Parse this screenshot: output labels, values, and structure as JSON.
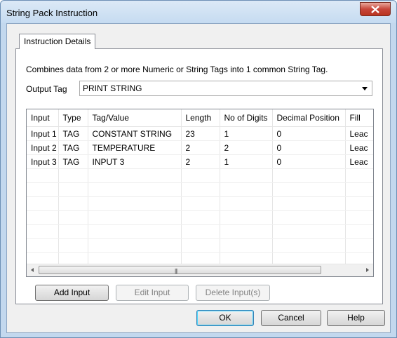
{
  "window": {
    "title": "String Pack Instruction"
  },
  "tabs": [
    {
      "label": "Instruction Details"
    }
  ],
  "description": "Combines data from 2 or more Numeric or String Tags into 1 common String Tag.",
  "output_tag": {
    "label": "Output Tag",
    "value": "PRINT STRING"
  },
  "grid": {
    "columns": [
      "Input",
      "Type",
      "Tag/Value",
      "Length",
      "No of Digits",
      "Decimal Position",
      "Fill"
    ],
    "rows": [
      [
        "Input 1",
        "TAG",
        "CONSTANT STRING",
        "23",
        "1",
        "0",
        "Leac"
      ],
      [
        "Input 2",
        "TAG",
        "TEMPERATURE",
        "2",
        "2",
        "0",
        "Leac"
      ],
      [
        "Input 3",
        "TAG",
        "INPUT 3",
        "2",
        "1",
        "0",
        "Leac"
      ]
    ]
  },
  "buttons": {
    "add_input": "Add Input",
    "edit_input": "Edit Input",
    "delete_input": "Delete Input(s)",
    "ok": "OK",
    "cancel": "Cancel",
    "help": "Help"
  }
}
